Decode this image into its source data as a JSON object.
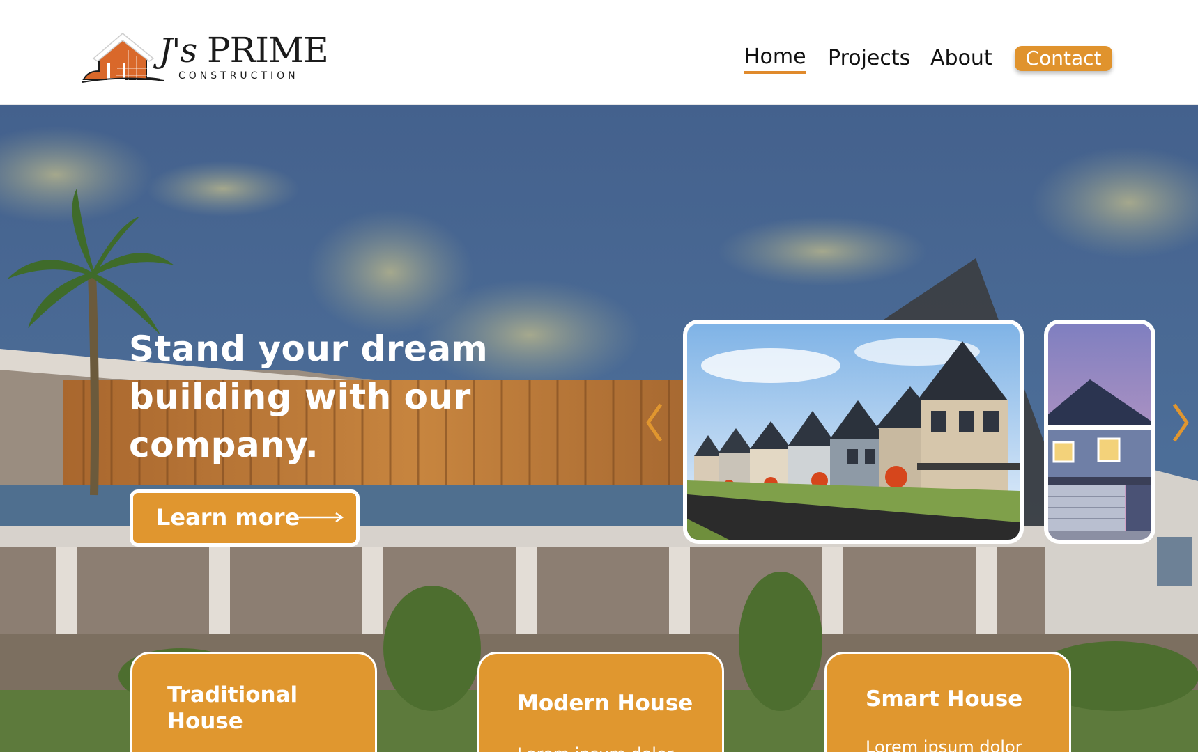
{
  "brand": {
    "name": "J's PRIME",
    "name_prefix": "J's",
    "name_main": "PRIME",
    "tagline": "CONSTRUCTION"
  },
  "nav": {
    "items": [
      {
        "label": "Home",
        "active": true
      },
      {
        "label": "Projects",
        "active": false
      },
      {
        "label": "About",
        "active": false
      }
    ],
    "contact_label": "Contact"
  },
  "hero": {
    "title": "Stand your dream building with  our company.",
    "cta_label": "Learn more"
  },
  "carousel": {
    "prev_icon": "chevron-left-icon",
    "next_icon": "chevron-right-icon",
    "slides": [
      {
        "name": "suburban-row-houses"
      },
      {
        "name": "blue-house-garage"
      }
    ]
  },
  "cards": [
    {
      "title": "Traditional House",
      "text": ""
    },
    {
      "title": "Modern House",
      "text": "Lorem ipsum dolor"
    },
    {
      "title": "Smart House",
      "text": "Lorem ipsum dolor"
    }
  ],
  "colors": {
    "accent": "#e0962f",
    "text_dark": "#111111",
    "sky": "#4a6690",
    "white": "#ffffff"
  }
}
